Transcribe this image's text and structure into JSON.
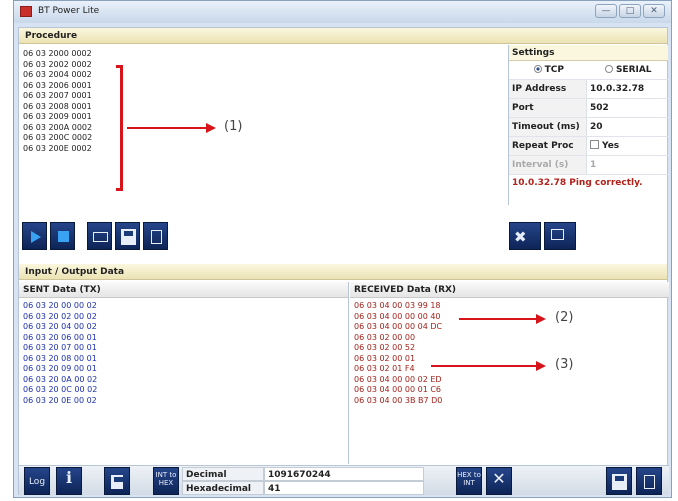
{
  "window": {
    "title": "BT Power Lite",
    "buttons": [
      "—",
      "□",
      "✕"
    ]
  },
  "procedure": {
    "header": "Procedure",
    "lines": [
      "06 03 2000 0002",
      "06 03 2002 0002",
      "06 03 2004 0002",
      "06 03 2006 0001",
      "06 03 2007 0001",
      "06 03 2008 0001",
      "06 03 2009 0001",
      "06 03 200A 0002",
      "06 03 200C 0002",
      "06 03 200E 0002"
    ],
    "annotation": "(1)"
  },
  "settings": {
    "header": "Settings",
    "protocol_options": [
      {
        "label": "TCP",
        "selected": true
      },
      {
        "label": "SERIAL",
        "selected": false
      }
    ],
    "ip_label": "IP Address",
    "ip_value": "10.0.32.78",
    "port_label": "Port",
    "port_value": "502",
    "timeout_label": "Timeout (ms)",
    "timeout_value": "20",
    "repeat_label": "Repeat Proc",
    "repeat_value": "Yes",
    "repeat_checked": false,
    "interval_label": "Interval (s)",
    "interval_value": "1",
    "status": "10.0.32.78 Ping correctly."
  },
  "toolbar_icons": [
    "play-icon",
    "stop-icon",
    "open-folder-icon",
    "save-icon",
    "delete-icon"
  ],
  "settings_icons": [
    "tools-icon",
    "network-icon"
  ],
  "io": {
    "header": "Input / Output Data",
    "sent_header": "SENT Data (TX)",
    "sent_lines": [
      "06 03 20 00 00 02",
      "06 03 20 02 00 02",
      "06 03 20 04 00 02",
      "06 03 20 06 00 01",
      "06 03 20 07 00 01",
      "06 03 20 08 00 01",
      "06 03 20 09 00 01",
      "06 03 20 0A 00 02",
      "06 03 20 0C 00 02",
      "06 03 20 0E 00 02"
    ],
    "received_header": "RECEIVED Data (RX)",
    "received_lines": [
      "06 03 04 00 03 99 18",
      "06 03 04 00 00 00 40",
      "06 03 04 00 00 04 DC",
      "06 03 02 00 00",
      "06 03 02 00 52",
      "06 03 02 00 01",
      "06 03 02 01 F4",
      "06 03 04 00 00 02 ED",
      "06 03 04 00 00 01 C6",
      "06 03 04 00 3B B7 D0"
    ],
    "annotation_2": "(2)",
    "annotation_3": "(3)"
  },
  "bottom": {
    "log_label": "Log",
    "info_label": "i",
    "int_to_hex_label": "INT to HEX",
    "hex_to_int_label": "HEX to INT",
    "decimal_label": "Decimal",
    "decimal_value": "1091670244",
    "hexadecimal_label": "Hexadecimal",
    "hexadecimal_value": "41"
  },
  "colors": {
    "accent_red": "#d8141b",
    "button_blue": "#1b3a78",
    "tx_text": "#1b2fb0",
    "rx_text": "#a3221c"
  }
}
